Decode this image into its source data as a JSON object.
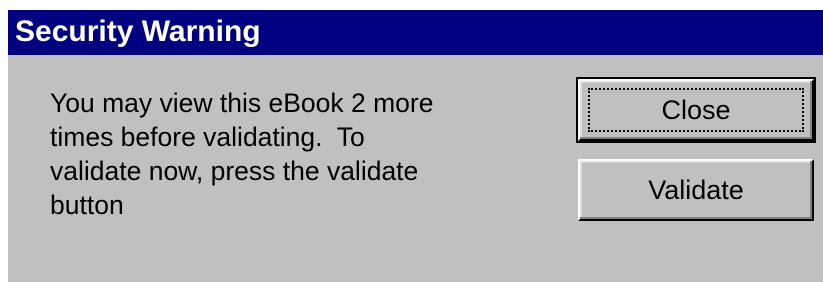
{
  "dialog": {
    "title": "Security Warning",
    "message_lines": [
      "You may view this eBook 2 more",
      "times before validating.  To",
      "validate now, press the validate",
      "button"
    ]
  },
  "buttons": {
    "close_label": "Close",
    "validate_label": "Validate"
  },
  "colors": {
    "title_bar": "#000080",
    "face": "#c0c0c0",
    "title_text": "#ffffff"
  }
}
